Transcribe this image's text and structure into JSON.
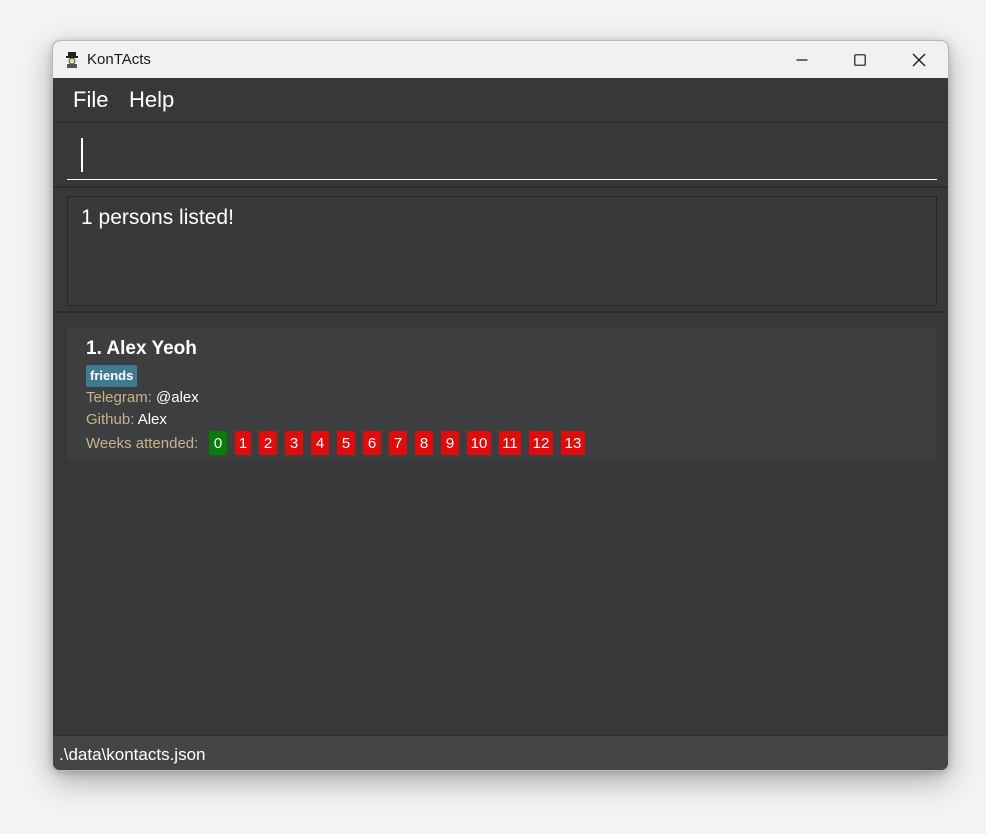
{
  "window": {
    "title": "KonTActs",
    "controls": [
      "minimize-icon",
      "maximize-icon",
      "close-icon"
    ]
  },
  "menu": {
    "items": [
      "File",
      "Help"
    ]
  },
  "command": {
    "value": ""
  },
  "result": {
    "message": "1 persons listed!"
  },
  "persons": [
    {
      "index_name": "1. Alex Yeoh",
      "tags": [
        "friends"
      ],
      "telegram_label": "Telegram:",
      "telegram": "@alex",
      "github_label": "Github:",
      "github": "Alex",
      "weeks_label": "Weeks attended:",
      "weeks": [
        "0",
        "1",
        "2",
        "3",
        "4",
        "5",
        "6",
        "7",
        "8",
        "9",
        "10",
        "11",
        "12",
        "13"
      ],
      "weeks_attended": [
        "0"
      ]
    }
  ],
  "status": {
    "path": ".\\data\\kontacts.json"
  },
  "colors": {
    "tag": "#3e7b91",
    "attended": "#0a7a0a",
    "missed": "#e00c0c",
    "label": "#c9b48a",
    "background": "#383838"
  }
}
